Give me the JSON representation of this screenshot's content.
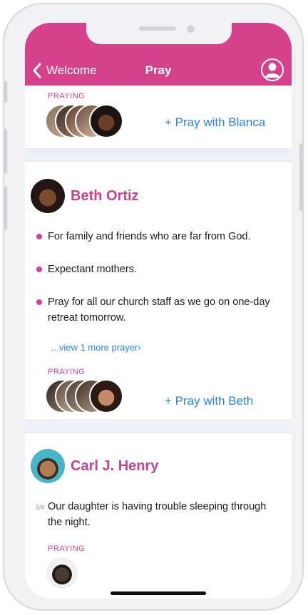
{
  "header": {
    "back_label": "Welcome",
    "title": "Pray",
    "brand_color": "#d6418e"
  },
  "sections": [
    {
      "praying_label": "PRAYING",
      "pray_with": "+ Pray with Blanca"
    },
    {
      "name": "Beth Ortiz",
      "requests": [
        "For family and friends who are far from God.",
        "Expectant mothers.",
        "Pray for all our church staff as we go on one-day retreat tomorrow."
      ],
      "view_more": "...view 1 more prayer›",
      "praying_label": "PRAYING",
      "pray_with": "+ Pray with Beth"
    },
    {
      "name": "Carl J. Henry",
      "date": "9/8",
      "request": "Our daughter is having trouble sleeping through the night.",
      "praying_label": "PRAYING"
    }
  ],
  "icons": {
    "back": "chevron-left-icon",
    "profile": "user-icon"
  },
  "colors": {
    "accent_pink": "#d6418e",
    "link_blue": "#2b85d8",
    "divider_bg": "#eef2f6"
  }
}
